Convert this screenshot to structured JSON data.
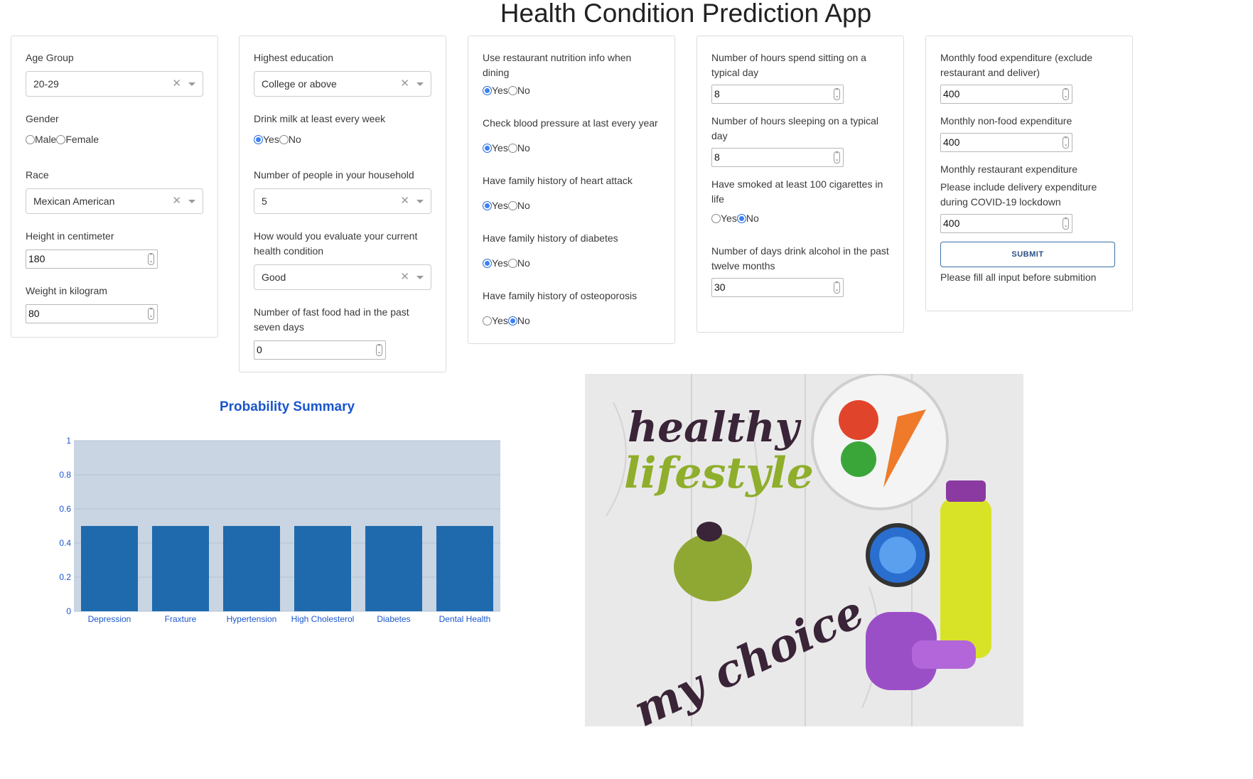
{
  "page": {
    "title": "Health Condition Prediction App"
  },
  "col1": {
    "age": {
      "label": "Age Group",
      "value": "20-29"
    },
    "gender": {
      "label": "Gender",
      "options": [
        "Male",
        "Female"
      ]
    },
    "race": {
      "label": "Race",
      "value": "Mexican American"
    },
    "height": {
      "label": "Height in centimeter",
      "value": "180"
    },
    "weight": {
      "label": "Weight in kilogram",
      "value": "80"
    }
  },
  "col2": {
    "education": {
      "label": "Highest education",
      "value": "College or above"
    },
    "milk": {
      "label": "Drink milk at least every week",
      "yes": "Yes",
      "no": "No"
    },
    "household": {
      "label": "Number of people in your household",
      "value": "5"
    },
    "health": {
      "label": "How would you evaluate your current health condition",
      "value": "Good"
    },
    "fastfood": {
      "label": "Number of fast food had in the past seven days",
      "value": "0"
    }
  },
  "col3": {
    "restaurant": {
      "label": "Use restaurant nutrition info when dining",
      "yes": "Yes",
      "no": "No"
    },
    "bp": {
      "label": "Check blood pressure at last every year",
      "yes": "Yes",
      "no": "No"
    },
    "heart": {
      "label": "Have family history of heart attack",
      "yes": "Yes",
      "no": "No"
    },
    "diabetes": {
      "label": "Have family history of diabetes",
      "yes": "Yes",
      "no": "No"
    },
    "osteo": {
      "label": "Have family history of osteoporosis",
      "yes": "Yes",
      "no": "No"
    }
  },
  "col4": {
    "sitting": {
      "label": "Number of hours spend sitting on a typical day",
      "value": "8"
    },
    "sleeping": {
      "label": "Number of hours sleeping on a typical day",
      "value": "8"
    },
    "smoked": {
      "label": "Have smoked at least 100 cigarettes in life",
      "yes": "Yes",
      "no": "No"
    },
    "alcohol": {
      "label": "Number of days drink alcohol in the past twelve months",
      "value": "30"
    }
  },
  "col5": {
    "food": {
      "label": "Monthly food expenditure (exclude restaurant and deliver)",
      "value": "400"
    },
    "nonfood": {
      "label": "Monthly non-food expenditure",
      "value": "400"
    },
    "restaurant_exp": {
      "label": "Monthly restaurant expenditure",
      "note": "Please include delivery expenditure during COVID-19 lockdown",
      "value": "400"
    },
    "submit_label": "SUBMIT",
    "hint": "Please fill all input before submition"
  },
  "poster": {
    "line1": "healthy",
    "line2": "lifestyle",
    "line3": "my choice"
  },
  "chart_data": {
    "type": "bar",
    "title": "Probability Summary",
    "categories": [
      "Depression",
      "Fraxture",
      "Hypertension",
      "High Cholesterol",
      "Diabetes",
      "Dental Health"
    ],
    "values": [
      0.5,
      0.5,
      0.5,
      0.5,
      0.5,
      0.5
    ],
    "yticks": [
      "0",
      "0.2",
      "0.4",
      "0.6",
      "0.8",
      "1"
    ],
    "ylim": [
      0,
      1
    ],
    "bar_color": "#1f6aad",
    "plot_bg": "#c9d5e3",
    "grid": true
  }
}
